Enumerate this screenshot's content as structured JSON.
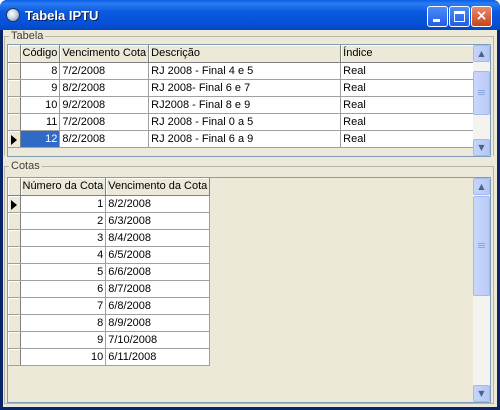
{
  "window": {
    "title": "Tabela IPTU",
    "buttons": {
      "minimize": "_",
      "maximize": "□",
      "close": "×"
    }
  },
  "tabela": {
    "legend": "Tabela",
    "columns": [
      "Código",
      "Vencimento Cota",
      "Descrição",
      "Índice"
    ],
    "rows": [
      {
        "codigo": "8",
        "vencimento": "7/2/2008",
        "descricao": "RJ 2008 - Final 4 e 5",
        "indice": "Real"
      },
      {
        "codigo": "9",
        "vencimento": "8/2/2008",
        "descricao": "RJ 2008- Final 6 e 7",
        "indice": "Real"
      },
      {
        "codigo": "10",
        "vencimento": "9/2/2008",
        "descricao": "RJ2008 - Final 8 e 9",
        "indice": "Real"
      },
      {
        "codigo": "11",
        "vencimento": "7/2/2008",
        "descricao": "RJ 2008 - Final 0 a 5",
        "indice": "Real"
      },
      {
        "codigo": "12",
        "vencimento": "8/2/2008",
        "descricao": "RJ 2008 - Final 6 a 9",
        "indice": "Real"
      }
    ],
    "selected_row": 4
  },
  "cotas": {
    "legend": "Cotas",
    "columns": [
      "Número da Cota",
      "Vencimento da Cota"
    ],
    "rows": [
      {
        "numero": "1",
        "vencimento": "8/2/2008"
      },
      {
        "numero": "2",
        "vencimento": "6/3/2008"
      },
      {
        "numero": "3",
        "vencimento": "8/4/2008"
      },
      {
        "numero": "4",
        "vencimento": "6/5/2008"
      },
      {
        "numero": "5",
        "vencimento": "6/6/2008"
      },
      {
        "numero": "6",
        "vencimento": "8/7/2008"
      },
      {
        "numero": "7",
        "vencimento": "6/8/2008"
      },
      {
        "numero": "8",
        "vencimento": "8/9/2008"
      },
      {
        "numero": "9",
        "vencimento": "7/10/2008"
      },
      {
        "numero": "10",
        "vencimento": "6/11/2008"
      }
    ],
    "current_row": 0
  },
  "icons": {
    "app": "app-globe-icon",
    "row_indicator": "row-pointer-icon",
    "scroll_up": "scroll-up-arrow-icon",
    "scroll_down": "scroll-down-arrow-icon"
  },
  "colors": {
    "titlebar": "#0550d6",
    "selection": "#316ac5",
    "window_face": "#ece9d8"
  }
}
